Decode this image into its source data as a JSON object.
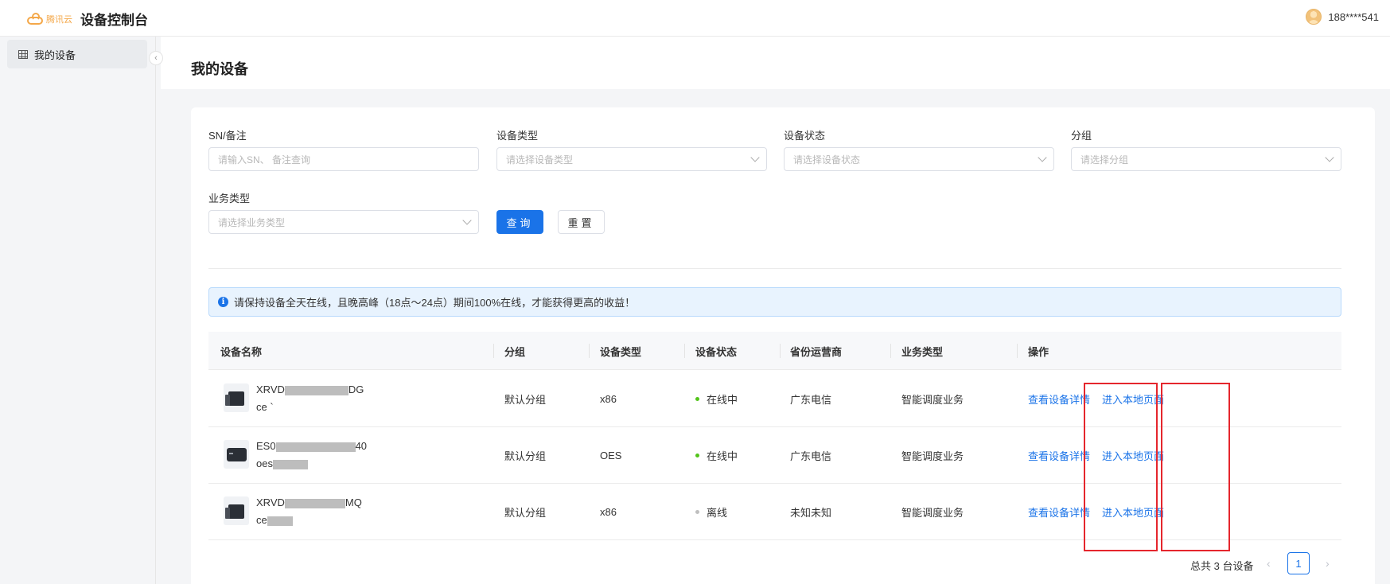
{
  "header": {
    "logo_text": "腾讯云",
    "title": "设备控制台",
    "user_name": "188****541"
  },
  "sidebar": {
    "items": [
      {
        "label": "我的设备",
        "icon": "table-grid-icon"
      }
    ],
    "collapse_icon": "‹"
  },
  "page": {
    "title": "我的设备"
  },
  "filters": {
    "sn_label": "SN/备注",
    "sn_placeholder": "请输入SN、 备注查询",
    "type_label": "设备类型",
    "type_placeholder": "请选择设备类型",
    "status_label": "设备状态",
    "status_placeholder": "请选择设备状态",
    "group_label": "分组",
    "group_placeholder": "请选择分组",
    "biz_label": "业务类型",
    "biz_placeholder": "请选择业务类型",
    "query_button": "查询",
    "reset_button": "重置"
  },
  "notice": {
    "text": "请保持设备全天在线，且晚高峰（18点～24点）期间100%在线，才能获得更高的收益！",
    "icon": "info-icon",
    "icon_glyph": "i"
  },
  "table": {
    "columns": [
      "设备名称",
      "分组",
      "设备类型",
      "设备状态",
      "省份运营商",
      "业务类型",
      "操作"
    ],
    "rows": [
      {
        "name_prefix": "XRVD",
        "name_suffix": "DG",
        "remark_prefix": "ce",
        "group": "默认分组",
        "device_type": "x86",
        "status": "在线中",
        "status_color": "#52c41a",
        "isp": "广东电信",
        "business": "智能调度业务",
        "action_detail": "查看设备详情",
        "action_local": "进入本地页面"
      },
      {
        "name_prefix": "ES0",
        "name_suffix": "40",
        "remark_prefix": "oes",
        "group": "默认分组",
        "device_type": "OES",
        "status": "在线中",
        "status_color": "#52c41a",
        "isp": "广东电信",
        "business": "智能调度业务",
        "action_detail": "查看设备详情",
        "action_local": "进入本地页面"
      },
      {
        "name_prefix": "XRVD",
        "name_suffix": "MQ",
        "remark_prefix": "ce",
        "group": "默认分组",
        "device_type": "x86",
        "status": "离线",
        "status_color": "#bfbfbf",
        "isp": "未知未知",
        "business": "智能调度业务",
        "action_detail": "查看设备详情",
        "action_local": "进入本地页面"
      }
    ]
  },
  "pagination": {
    "total_text": "总共 3 台设备",
    "current_page": "1",
    "prev_icon": "‹",
    "next_icon": "›"
  },
  "colors": {
    "primary": "#1a73e8",
    "online": "#52c41a",
    "offline": "#bfbfbf",
    "highlight": "#e5262d",
    "logo": "#f4a84a"
  }
}
